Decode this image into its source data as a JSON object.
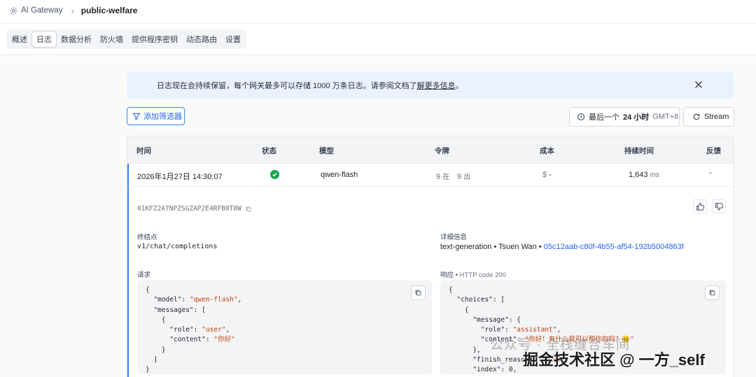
{
  "header": {
    "brand": "AI Gateway",
    "project": "public-welfare"
  },
  "tabs": [
    {
      "label": "概述",
      "active": false
    },
    {
      "label": "日志",
      "active": true
    },
    {
      "label": "数据分析",
      "active": false
    },
    {
      "label": "防火墙",
      "active": false
    },
    {
      "label": "提供程序密钥",
      "active": false
    },
    {
      "label": "动态路由",
      "active": false
    },
    {
      "label": "设置",
      "active": false
    }
  ],
  "banner": {
    "text_before": "日志现在会持续保留，每个网关最多可以存储 1000 万条日志。请参阅文档了",
    "link": "解更多信息",
    "text_after": "。"
  },
  "controls": {
    "filter_label": "添加筛选器",
    "range_prefix": "最后一个",
    "range_bold": "24 小时",
    "timezone": "GMT+8",
    "stream_label": "Stream"
  },
  "table": {
    "headers": [
      "时间",
      "状态",
      "模型",
      "令牌",
      "成本",
      "持续时间",
      "反馈"
    ],
    "row": {
      "time": "2026年1月27日 14:30:07",
      "model": "qwen-flash",
      "tokens_in": "9",
      "tokens_in_unit": "在",
      "tokens_out": "9",
      "tokens_out_unit": "出",
      "cost_symbol": "$",
      "cost": "-",
      "duration": "1,643",
      "duration_unit": "ms",
      "feedback": "-"
    }
  },
  "detail": {
    "request_id": "01KFZ2A7NPZSGZAP2E4RFB0T0W",
    "endpoint_label": "终结点",
    "endpoint": "v1/chat/completions",
    "info_label": "详细信息",
    "info_type": "text-generation",
    "info_user": "Tsuen Wan",
    "info_id": "05c12aab-c80f-4b55-af54-192b5004863f",
    "request_label": "请求",
    "response_label": "响应",
    "response_code": "HTTP code 200"
  },
  "watermark": {
    "line1": "公众号 · 全栈缝合车间",
    "line2": "掘金技术社区 @ 一方_self"
  },
  "colors": {
    "accent": "#3b82f6",
    "success": "#16a34a",
    "banner_bg": "#eaf3fd",
    "string": "#c2410c"
  }
}
